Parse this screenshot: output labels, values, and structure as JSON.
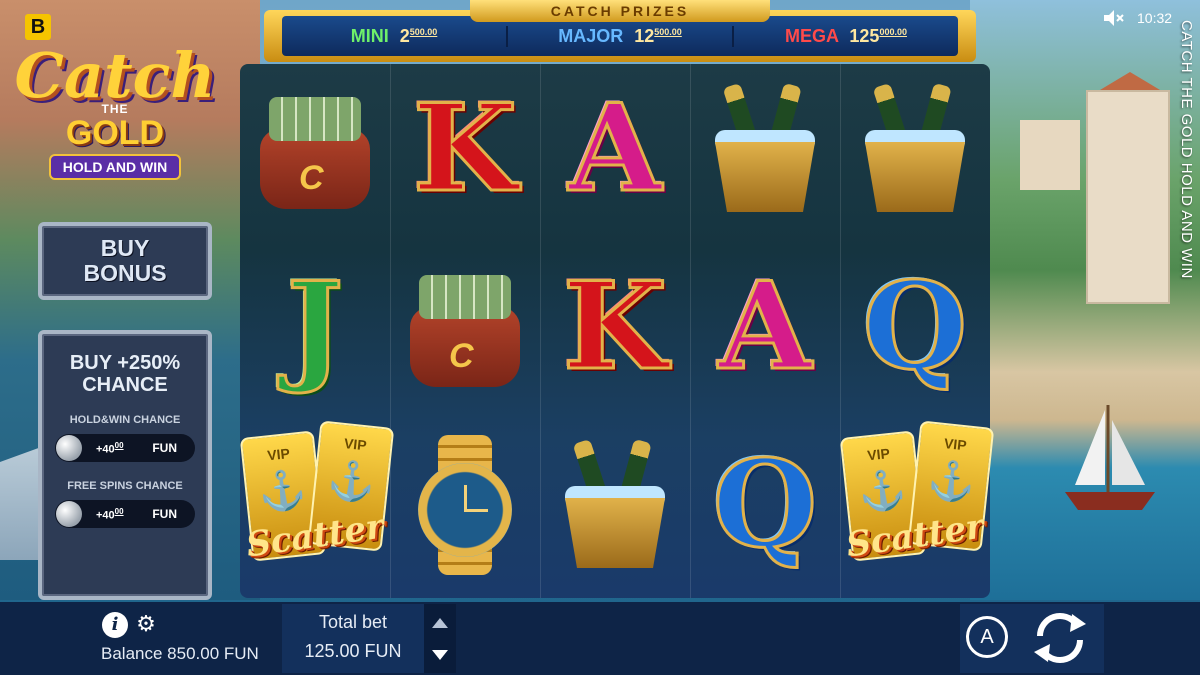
{
  "app": {
    "badge": "B",
    "clock": "10:32",
    "side_title": "CATCH THE GOLD HOLD AND WIN"
  },
  "logo": {
    "catch": "Catch",
    "the": "THE",
    "gold": "GOLD",
    "hold_and_win": "HOLD AND WIN"
  },
  "prizes": {
    "title": "CATCH PRIZES",
    "mini": {
      "label": "MINI",
      "value": "2",
      "decimals": "500.00"
    },
    "major": {
      "label": "MAJOR",
      "value": "12",
      "decimals": "500.00"
    },
    "mega": {
      "label": "MEGA",
      "value": "125",
      "decimals": "000.00"
    }
  },
  "buy_bonus": {
    "line1": "BUY",
    "line2": "BONUS"
  },
  "chance_panel": {
    "title_line1": "BUY +250%",
    "title_line2": "CHANCE",
    "hold_win_label": "HOLD&WIN CHANCE",
    "hold_win_value": "+40",
    "hold_win_decimals": "00",
    "hold_win_currency": "FUN",
    "free_spins_label": "FREE SPINS CHANCE",
    "free_spins_value": "+40",
    "free_spins_decimals": "00",
    "free_spins_currency": "FUN"
  },
  "reels": [
    [
      "bag",
      "J",
      "scatter"
    ],
    [
      "K",
      "bag",
      "watch"
    ],
    [
      "A",
      "K",
      "bucket"
    ],
    [
      "bucket",
      "A",
      "Q"
    ],
    [
      "bucket",
      "Q",
      "scatter"
    ]
  ],
  "symbols": {
    "scatter_text": "Scatter",
    "vip": "VIP",
    "bag_letter": "C"
  },
  "bottom": {
    "balance": "Balance 850.00 FUN",
    "total_bet_label": "Total bet",
    "total_bet_value": "125.00 FUN",
    "auto_label": "A"
  },
  "icons": [
    "info-icon",
    "gear-icon",
    "sound-muted-icon",
    "autoplay-icon",
    "spin-icon",
    "arrow-up-icon",
    "arrow-down-icon"
  ],
  "colors": {
    "frame_gold": "#f5c400",
    "panel": "#2d3b55",
    "bottom_bar": "#0e2447"
  }
}
